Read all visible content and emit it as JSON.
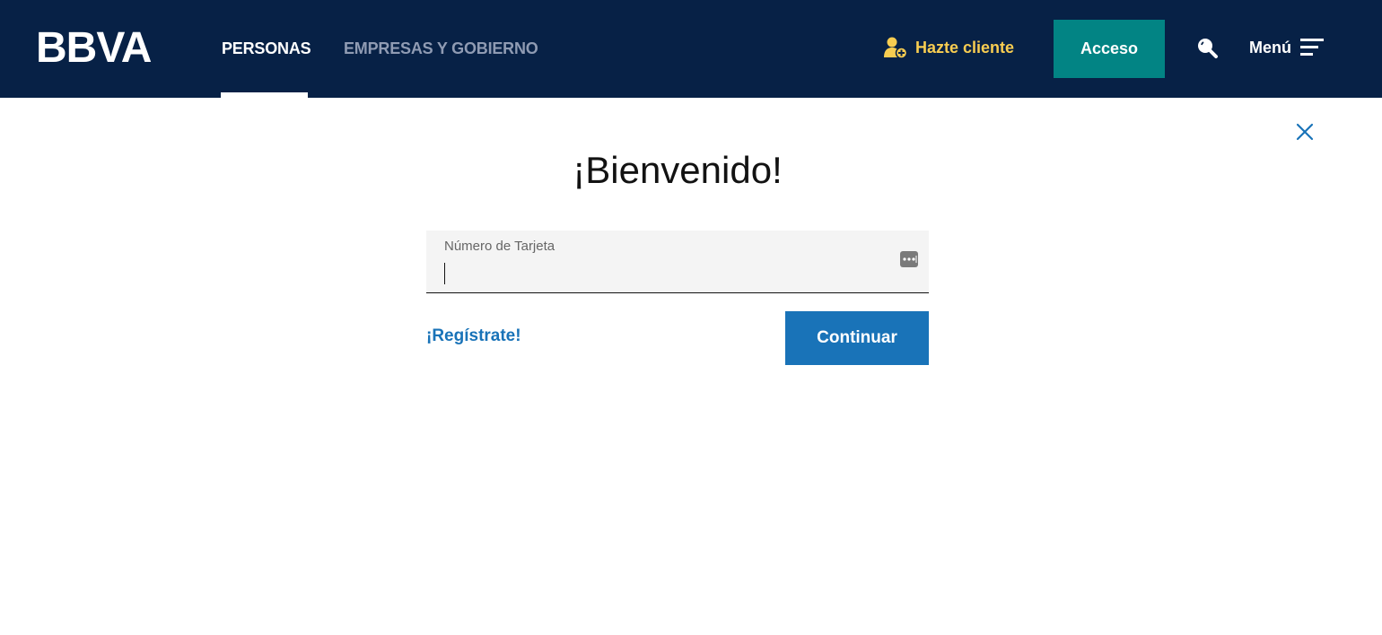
{
  "header": {
    "logo": "BBVA",
    "tabs": [
      {
        "label": "PERSONAS",
        "active": true
      },
      {
        "label": "EMPRESAS Y GOBIERNO",
        "active": false
      }
    ],
    "hazte_cliente": "Hazte cliente",
    "acceso": "Acceso",
    "menu": "Menú",
    "icons": {
      "hazte": "user-plus-icon",
      "search": "search-icon",
      "menu": "hamburger-icon"
    }
  },
  "login": {
    "title": "¡Bienvenido!",
    "card_field": {
      "label": "Número de Tarjeta",
      "value": ""
    },
    "register_link": "¡Regístrate!",
    "continue_button": "Continuar",
    "icons": {
      "close": "close-icon",
      "password": "password-dots-icon"
    }
  },
  "colors": {
    "header_bg": "#072146",
    "accent_teal": "#028484",
    "primary_blue": "#1973b8",
    "yellow": "#f8cd51",
    "inactive_nav": "#8f9bb3",
    "field_bg": "#f4f4f4"
  }
}
